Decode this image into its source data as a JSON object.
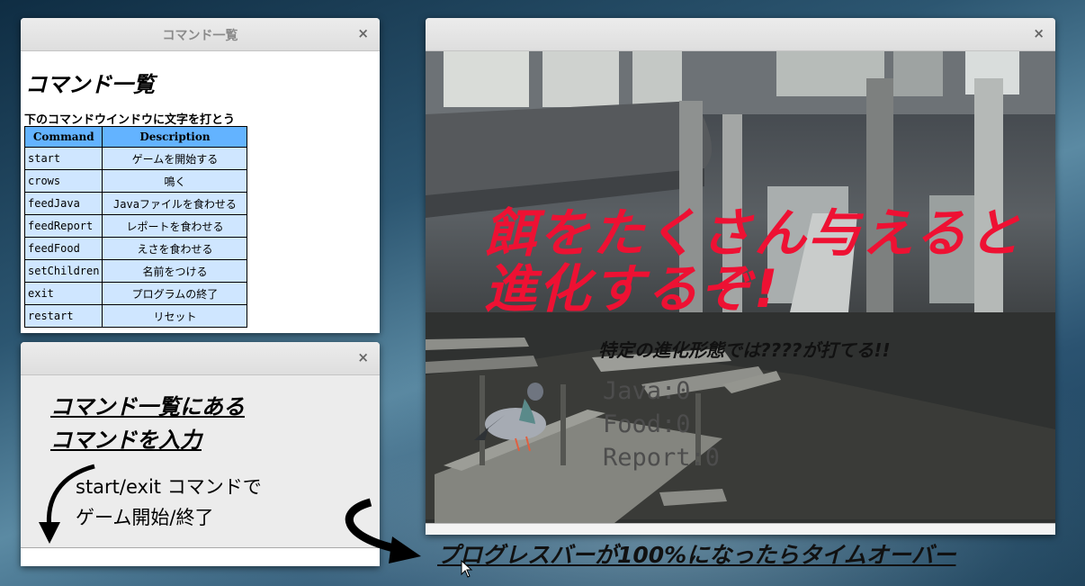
{
  "command_window": {
    "title": "コマンド一覧",
    "heading": "コマンド一覧",
    "subtitle": "下のコマンドウインドウに文字を打とう",
    "columns": [
      "Command",
      "Description"
    ],
    "rows": [
      [
        "start",
        "ゲームを開始する"
      ],
      [
        "crows",
        "鳴く"
      ],
      [
        "feedJava",
        "Javaファイルを食わせる"
      ],
      [
        "feedReport",
        "レポートを食わせる"
      ],
      [
        "feedFood",
        "えさを食わせる"
      ],
      [
        "setChildren",
        "名前をつける"
      ],
      [
        "exit",
        "プログラムの終了"
      ],
      [
        "restart",
        "リセット"
      ]
    ]
  },
  "input_window": {
    "title": "",
    "heading_line1": "コマンド一覧にある",
    "heading_line2": "コマンドを入力",
    "hint_line1": "start/exit コマンドで",
    "hint_line2": "ゲーム開始/終了",
    "input_value": ""
  },
  "game_window": {
    "title": "",
    "big_message_line1": "餌をたくさん与えると",
    "big_message_line2": "進化するぞ!",
    "evolution_hint": "特定の進化形態では????が打てる!!",
    "stats": [
      "Java:0",
      "Food:0",
      "Report:0"
    ],
    "progress_value": 0
  },
  "bottom_note": "プログレスバーが100%になったらタイムオーバー",
  "close_symbol": "×",
  "colors": {
    "header_blue": "#63b3ff",
    "cell_blue": "#cfe6ff",
    "message_red": "#ee1133"
  }
}
